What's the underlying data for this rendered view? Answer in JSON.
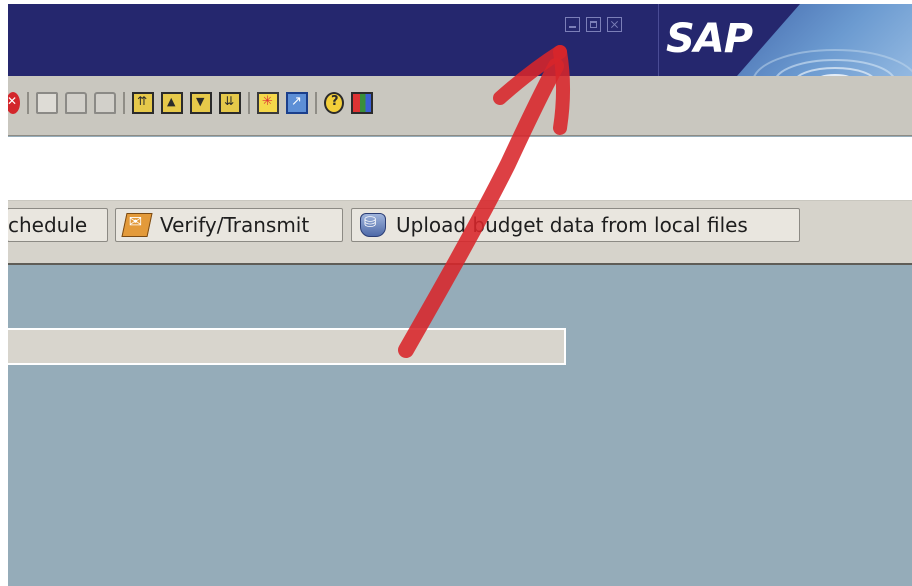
{
  "window": {
    "controls": [
      {
        "name": "minimize-icon"
      },
      {
        "name": "maximize-icon"
      },
      {
        "name": "close-icon"
      }
    ]
  },
  "branding": {
    "logo_text": "SAP"
  },
  "toolbar": {
    "icons": [
      "cancel-icon",
      "print-icon",
      "find-icon",
      "find-next-icon",
      "first-page-icon",
      "previous-page-icon",
      "next-page-icon",
      "last-page-icon",
      "create-session-icon",
      "create-shortcut-icon",
      "help-icon",
      "customize-layout-icon"
    ]
  },
  "app_toolbar": {
    "schedule_label": "chedule",
    "verify_label": "Verify/Transmit",
    "upload_label": "Upload budget data from local files"
  },
  "annotation": {
    "color": "#d8262a"
  },
  "colors": {
    "titlebar": "#25276e",
    "toolbar": "#c9c7bf",
    "content_bg": "#95acb9"
  }
}
